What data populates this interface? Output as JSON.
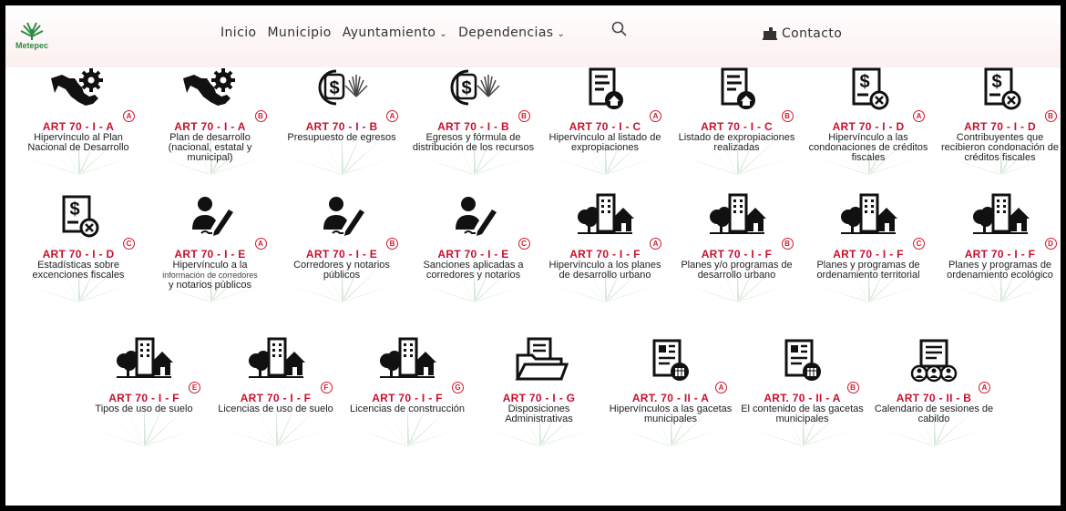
{
  "site": {
    "logo_text": "Metepec"
  },
  "nav": {
    "items": [
      {
        "label": "Inicio",
        "dropdown": false
      },
      {
        "label": "Municipio",
        "dropdown": false
      },
      {
        "label": "Ayuntamiento",
        "dropdown": true
      },
      {
        "label": "Dependencias",
        "dropdown": true
      }
    ],
    "search_icon": "search-icon",
    "search_placeholder": "",
    "contact_label": "Contacto",
    "contact_icon": "mailbox-icon"
  },
  "colors": {
    "accent": "#c8102e",
    "badge": "#d11a2a",
    "agave": "#cfe3d2"
  },
  "tiles": [
    {
      "art": "ART 70 - I - A",
      "badge": "A",
      "desc": "Hipervínculo al Plan Nacional de Desarrollo",
      "icon": "mexico-map-gear-icon"
    },
    {
      "art": "ART 70 - I - A",
      "badge": "B",
      "desc": "Plan de desarrollo (nacional, estatal y municipal)",
      "icon": "mexico-map-gear-icon"
    },
    {
      "art": "ART 70 - I - B",
      "badge": "A",
      "desc": "Presupuesto de egresos",
      "icon": "dollar-agave-icon"
    },
    {
      "art": "ART 70 - I - B",
      "badge": "B",
      "desc": "Egresos y fórmula de distribución de los recursos",
      "icon": "dollar-agave-icon"
    },
    {
      "art": "ART 70 - I - C",
      "badge": "A",
      "desc": "Hipervínculo al listado de expropiaciones",
      "icon": "document-house-icon"
    },
    {
      "art": "ART 70 - I - C",
      "badge": "B",
      "desc": "Listado de expropiaciones realizadas",
      "icon": "document-house-icon"
    },
    {
      "art": "ART 70 - I - D",
      "badge": "A",
      "desc": "Hipervínculo a las condonaciones de créditos fiscales",
      "icon": "dollar-document-x-icon"
    },
    {
      "art": "ART 70 - I - D",
      "badge": "B",
      "desc": "Contribuyentes que recibieron condonación de créditos fiscales",
      "icon": "dollar-document-x-icon"
    },
    {
      "art": "ART 70 - I - D",
      "badge": "C",
      "desc": "Estadísticas sobre excenciones fiscales",
      "icon": "dollar-document-x-icon"
    },
    {
      "art": "ART 70 - I - E",
      "badge": "A",
      "desc_main": "Hipervínculo a la",
      "desc_small": "información de corredores",
      "desc_end": "y notarios públicos",
      "icon": "person-pen-icon"
    },
    {
      "art": "ART 70 - I - E",
      "badge": "B",
      "desc": "Corredores y notarios públicos",
      "icon": "person-pen-icon"
    },
    {
      "art": "ART 70 - I - E",
      "badge": "C",
      "desc": "Sanciones aplicadas a corredores y notarios",
      "icon": "person-pen-icon"
    },
    {
      "art": "ART 70 - I - F",
      "badge": "A",
      "desc": "Hipervínculo a los planes de desarrollo urbano",
      "icon": "city-tree-house-icon"
    },
    {
      "art": "ART 70 - I - F",
      "badge": "B",
      "desc": "Planes y/o programas de desarrollo urbano",
      "icon": "city-tree-house-icon"
    },
    {
      "art": "ART 70 - I - F",
      "badge": "C",
      "desc": "Planes y programas de ordenamiento territorial",
      "icon": "city-tree-house-icon"
    },
    {
      "art": "ART 70 - I - F",
      "badge": "D",
      "desc": "Planes y programas de ordenamiento ecológico",
      "icon": "city-tree-house-icon"
    },
    {
      "art": "ART 70 - I - F",
      "badge": "E",
      "desc": "Tipos de uso de suelo",
      "icon": "city-tree-house-icon"
    },
    {
      "art": "ART 70 - I - F",
      "badge": "F",
      "desc": "Licencias de uso de suelo",
      "icon": "city-tree-house-icon"
    },
    {
      "art": "ART 70 - I - F",
      "badge": "G",
      "desc": "Licencias de construcción",
      "icon": "city-tree-house-icon"
    },
    {
      "art": "ART 70 - I - G",
      "badge": "",
      "desc": "Disposiciones Administrativas",
      "icon": "folder-document-icon"
    },
    {
      "art": "ART. 70 - II - A",
      "badge": "A",
      "desc": "Hipervínculos a las gacetas municipales",
      "icon": "gazette-calendar-icon"
    },
    {
      "art": "ART. 70 - II - A",
      "badge": "B",
      "desc": "El contenido de las gacetas municipales",
      "icon": "gazette-calendar-icon"
    },
    {
      "art": "ART 70 - II - B",
      "badge": "A",
      "desc": "Calendario de sesiones de cabildo",
      "icon": "document-people-icon"
    }
  ]
}
